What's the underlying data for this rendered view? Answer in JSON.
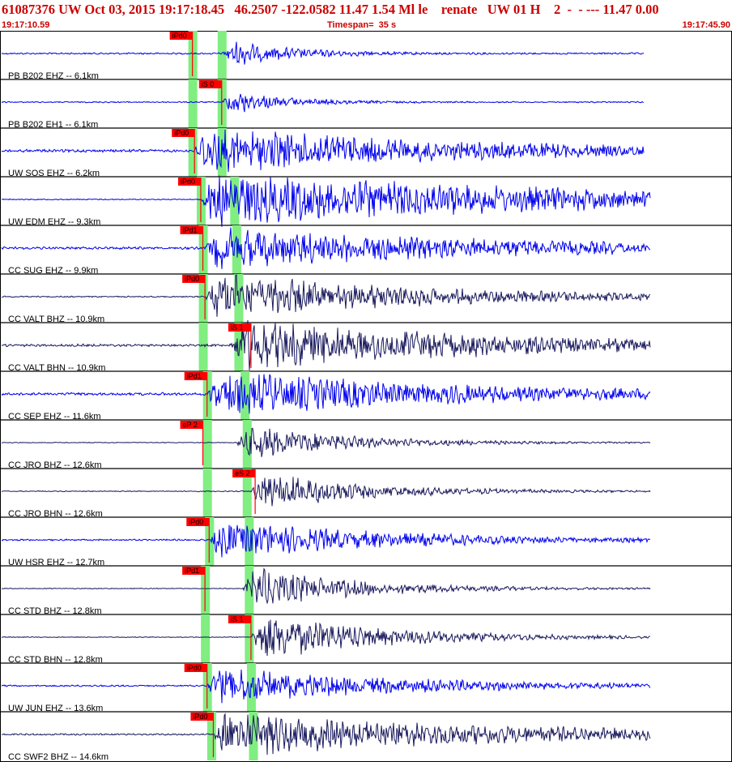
{
  "header": {
    "title": "61087376 UW Oct 03, 2015 19:17:18.45   46.2507 -122.0582 11.47 1.54 Ml le    renate   UW 01 H    2  -  - --- 11.47 0.00",
    "start_time": "19:17:10.59",
    "timespan": "Timespan=  35 s",
    "end_time": "19:17:45.90"
  },
  "colors": {
    "blue": "#0000ee",
    "navy": "#1a1a5e",
    "pick": "#ff0000",
    "phase_band": "#80ee80",
    "title": "#cc0000"
  },
  "chart_data": {
    "type": "seismogram",
    "x_axis": {
      "start": "19:17:10.59",
      "end": "19:17:45.90",
      "span_s": 35
    },
    "traces": [
      {
        "label": "PB B202 EHZ -- 6.1km",
        "color": "blue",
        "p_time": 9.2,
        "s_time": 10.6,
        "picks": [
          {
            "label": "iPd0",
            "t": 9.2
          }
        ],
        "amp": 14,
        "onset": 10.6,
        "decay": 3,
        "noise": 0.8,
        "end": 30.8
      },
      {
        "label": "PB B202 EH1 -- 6.1km",
        "color": "blue",
        "p_time": 9.2,
        "s_time": 10.6,
        "picks": [
          {
            "label": "iS 0",
            "t": 10.6
          }
        ],
        "amp": 16,
        "onset": 10.6,
        "decay": 2.5,
        "noise": 0.6,
        "end": 30.8
      },
      {
        "label": "UW SOS EHZ -- 6.2km",
        "color": "blue",
        "p_time": 9.2,
        "s_time": 10.6,
        "picks": [
          {
            "label": "iPd0",
            "t": 9.3
          }
        ],
        "amp": 24,
        "onset": 9.3,
        "decay": 12,
        "noise": 1.4,
        "end": 30.8
      },
      {
        "label": "UW EDM EHZ -- 9.3km",
        "color": "blue",
        "p_time": 9.6,
        "s_time": 11.2,
        "picks": [
          {
            "label": "iPd0",
            "t": 9.6
          }
        ],
        "amp": 26,
        "onset": 9.6,
        "decay": 20,
        "noise": 0.5,
        "end": 31.1
      },
      {
        "label": "CC SUG EHZ -- 9.9km",
        "color": "blue",
        "p_time": 9.7,
        "s_time": 11.3,
        "picks": [
          {
            "label": "iPd1",
            "t": 9.7
          }
        ],
        "amp": 20,
        "onset": 9.8,
        "decay": 14,
        "noise": 1.2,
        "end": 31.1
      },
      {
        "label": "CC VALT BHZ -- 10.9km",
        "color": "navy",
        "p_time": 9.7,
        "s_time": 11.4,
        "picks": [
          {
            "label": "iPd0",
            "t": 9.8
          }
        ],
        "amp": 24,
        "onset": 9.8,
        "decay": 10,
        "noise": 0.6,
        "end": 31.1
      },
      {
        "label": "CC VALT BHN -- 10.9km",
        "color": "navy",
        "p_time": 9.7,
        "s_time": 11.4,
        "picks": [
          {
            "label": "iS 1",
            "t": 12.0
          }
        ],
        "amp": 26,
        "onset": 11.0,
        "decay": 12,
        "noise": 1.2,
        "end": 31.1
      },
      {
        "label": "CC SEP EHZ -- 11.6km",
        "color": "blue",
        "p_time": 9.9,
        "s_time": 11.7,
        "picks": [
          {
            "label": "iPd1",
            "t": 9.9
          }
        ],
        "amp": 22,
        "onset": 9.9,
        "decay": 12,
        "noise": 1.4,
        "end": 31.1
      },
      {
        "label": "CC JRO BHZ -- 12.6km",
        "color": "navy",
        "p_time": 9.9,
        "s_time": 11.8,
        "picks": [
          {
            "label": "eP 2",
            "t": 9.7
          }
        ],
        "amp": 18,
        "onset": 11.3,
        "decay": 5,
        "noise": 0.4,
        "end": 31.1
      },
      {
        "label": "CC JRO BHN -- 12.6km",
        "color": "navy",
        "p_time": 9.9,
        "s_time": 11.8,
        "picks": [
          {
            "label": "eS 2",
            "t": 12.2
          }
        ],
        "amp": 20,
        "onset": 12.0,
        "decay": 5,
        "noise": 0.5,
        "end": 31.1
      },
      {
        "label": "UW HSR EHZ -- 12.7km",
        "color": "blue",
        "p_time": 10.0,
        "s_time": 11.9,
        "picks": [
          {
            "label": "iPd0",
            "t": 10.0
          }
        ],
        "amp": 20,
        "onset": 10.0,
        "decay": 8,
        "noise": 0.8,
        "end": 31.1
      },
      {
        "label": "CC STD BHZ -- 12.8km",
        "color": "navy",
        "p_time": 9.8,
        "s_time": 11.9,
        "picks": [
          {
            "label": "iPd1",
            "t": 9.8
          }
        ],
        "amp": 22,
        "onset": 11.6,
        "decay": 5,
        "noise": 0.4,
        "end": 31.1
      },
      {
        "label": "CC STD BHN -- 12.8km",
        "color": "navy",
        "p_time": 9.8,
        "s_time": 11.9,
        "picks": [
          {
            "label": "iS 1",
            "t": 12.0
          }
        ],
        "amp": 24,
        "onset": 12.0,
        "decay": 6,
        "noise": 0.4,
        "end": 31.1
      },
      {
        "label": "UW JUN EHZ -- 13.6km",
        "color": "blue",
        "p_time": 9.9,
        "s_time": 12.0,
        "picks": [
          {
            "label": "iPd0",
            "t": 9.9
          }
        ],
        "amp": 18,
        "onset": 9.9,
        "decay": 9,
        "noise": 0.8,
        "end": 31.1
      },
      {
        "label": "CC SWF2 BHZ -- 14.6km",
        "color": "navy",
        "p_time": 10.1,
        "s_time": 12.1,
        "picks": [
          {
            "label": "iPd0",
            "t": 10.2
          }
        ],
        "amp": 22,
        "onset": 10.2,
        "decay": 14,
        "noise": 0.8,
        "end": 31.1
      }
    ]
  }
}
